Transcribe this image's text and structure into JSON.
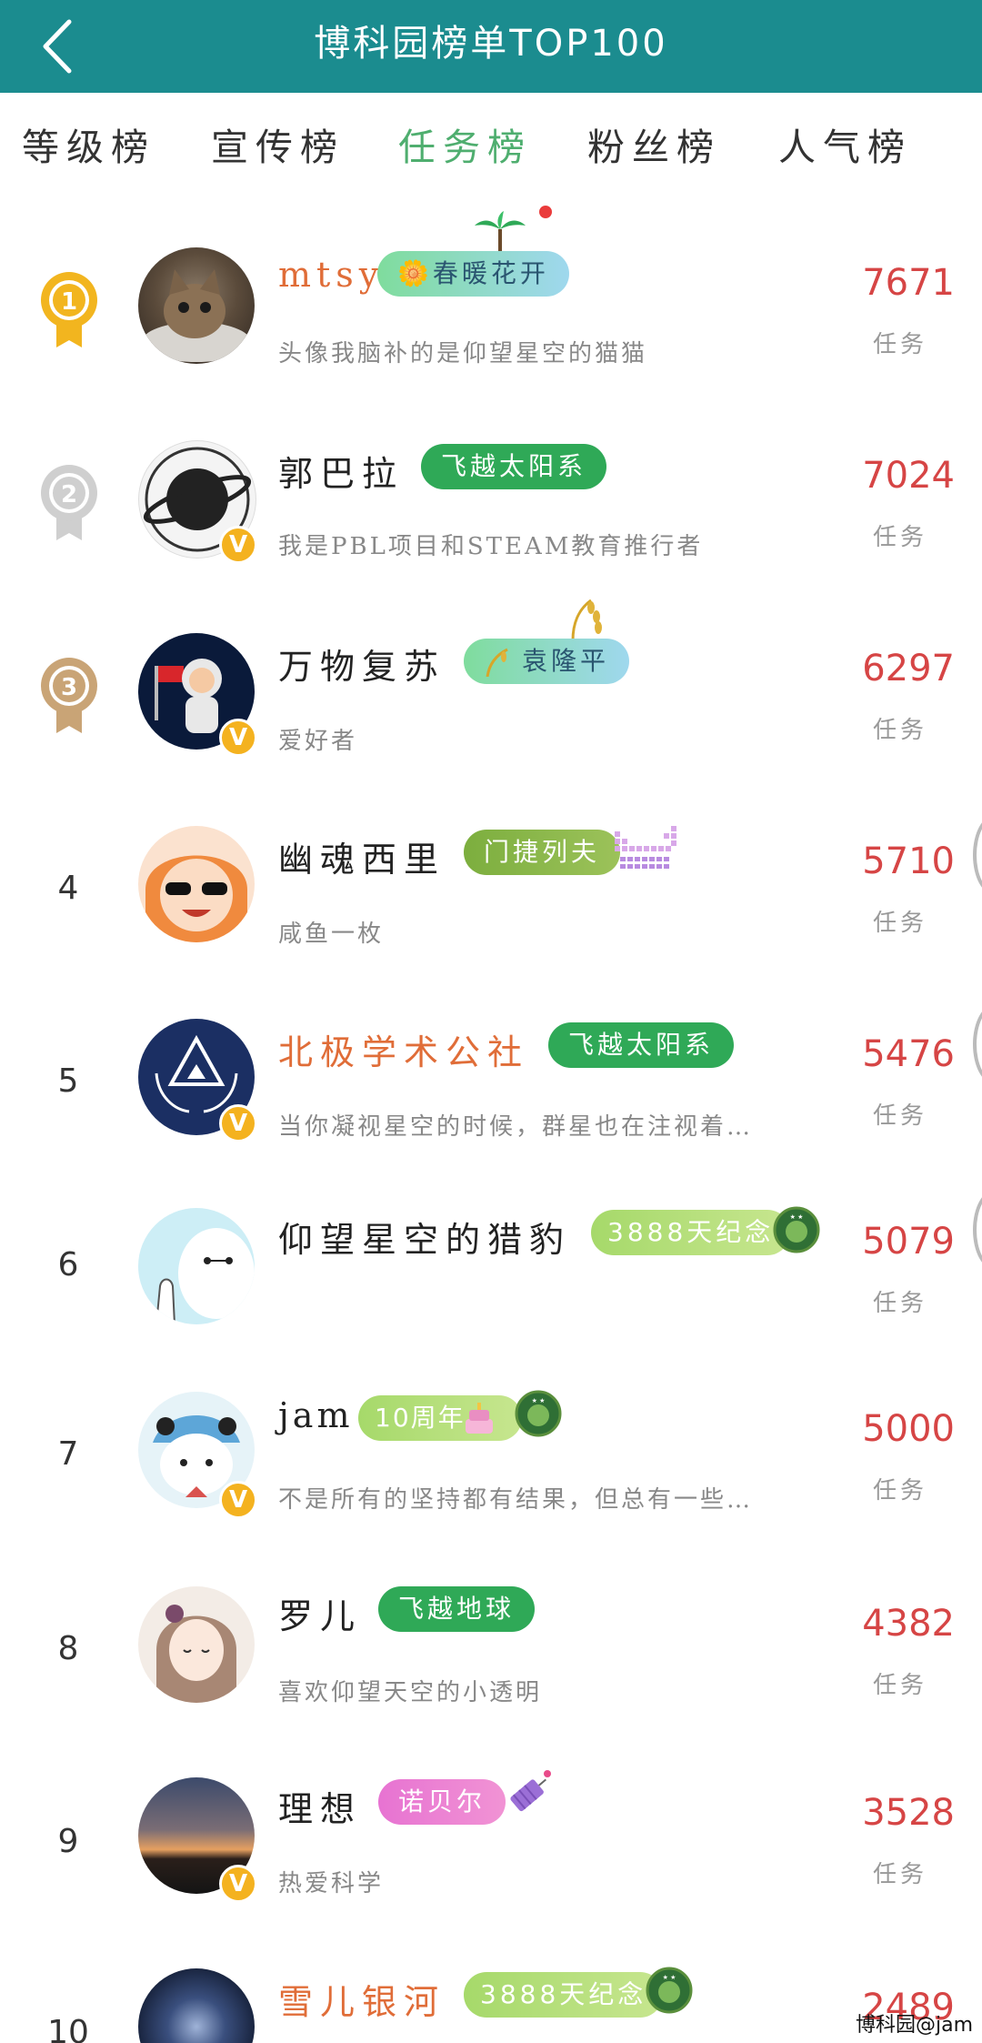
{
  "header": {
    "title": "博科园榜单TOP100"
  },
  "tabs": [
    {
      "label": "等级榜"
    },
    {
      "label": "宣传榜"
    },
    {
      "label": "任务榜"
    },
    {
      "label": "粉丝榜"
    },
    {
      "label": "人气榜"
    }
  ],
  "active_tab": 2,
  "unit_label": "任务",
  "rows": [
    {
      "rank": "1",
      "name": "mtsy",
      "badge": "🌼春暖花开",
      "signature": "头像我脑补的是仰望星空的猫猫",
      "score": "7671"
    },
    {
      "rank": "2",
      "name": "郭巴拉",
      "badge": "飞越太阳系",
      "signature": "我是PBL项目和STEAM教育推行者",
      "score": "7024"
    },
    {
      "rank": "3",
      "name": "万物复苏",
      "badge": "袁隆平",
      "signature": "爱好者",
      "score": "6297"
    },
    {
      "rank": "4",
      "name": "幽魂西里",
      "badge": "门捷列夫",
      "signature": "咸鱼一枚",
      "score": "5710"
    },
    {
      "rank": "5",
      "name": "北极学术公社",
      "badge": "飞越太阳系",
      "signature": "当你凝视星空的时候，群星也在注视着…",
      "score": "5476"
    },
    {
      "rank": "6",
      "name": "仰望星空的猎豹",
      "badge": "3888天纪念",
      "signature": "",
      "score": "5079"
    },
    {
      "rank": "7",
      "name": "jam",
      "badge": "10周年",
      "signature": "不是所有的坚持都有结果，但总有一些…",
      "score": "5000"
    },
    {
      "rank": "8",
      "name": "罗儿",
      "badge": "飞越地球",
      "signature": "喜欢仰望天空的小透明",
      "score": "4382"
    },
    {
      "rank": "9",
      "name": "理想",
      "badge": "诺贝尔",
      "signature": "热爱科学",
      "score": "3528"
    },
    {
      "rank": "10",
      "name": "雪儿银河",
      "badge": "3888天纪念",
      "signature": "",
      "score": "2489"
    }
  ],
  "verified_mark": "V",
  "watermark": "博科园@jam",
  "colors": {
    "header": "#1b8c8f",
    "active_tab": "#4fae6f",
    "score": "#d64545"
  }
}
